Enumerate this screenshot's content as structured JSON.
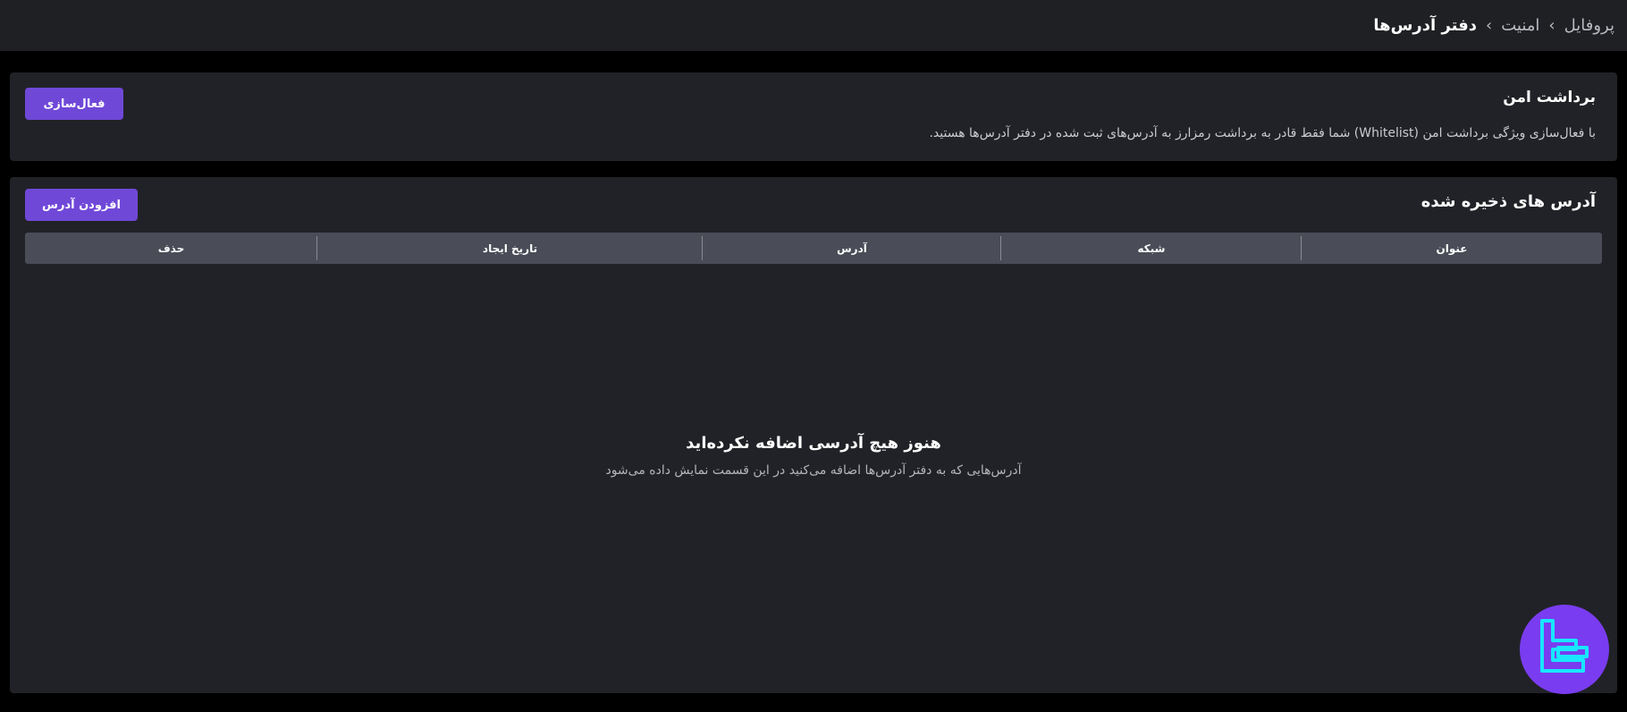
{
  "breadcrumb": {
    "items": [
      "پروفایل",
      "امنیت",
      "دفتر آدرس‌ها"
    ],
    "separator": "›"
  },
  "secure_withdrawal": {
    "title": "برداشت امن",
    "description": "با فعال‌سازی ویژگی برداشت امن (Whitelist) شما فقط قادر به برداشت رمزارز به آدرس‌های ثبت شده در دفتر آدرس‌ها هستید.",
    "activate_label": "فعال‌سازی"
  },
  "saved_addresses": {
    "title": "آدرس های ذخیره شده",
    "add_label": "افزودن آدرس",
    "columns": [
      "عنوان",
      "شبکه",
      "آدرس",
      "تاریخ ایجاد",
      "حذف"
    ],
    "empty_title": "هنوز هیچ آدرسی اضافه نکرده‌اید",
    "empty_subtitle": "آدرس‌هایی که به دفتر آدرس‌ها اضافه می‌کنید در این قسمت نمایش داده می‌شود"
  },
  "colors": {
    "accent": "#7048d8",
    "background": "#000000",
    "panel": "#212227",
    "table_header": "#4a4d57",
    "logo_bg": "#7a3cf0",
    "logo_fg": "#19e6ff"
  },
  "icons": {
    "breadcrumb_separator": "chevron-left-icon",
    "floating_logo": "brand-logo-icon"
  }
}
